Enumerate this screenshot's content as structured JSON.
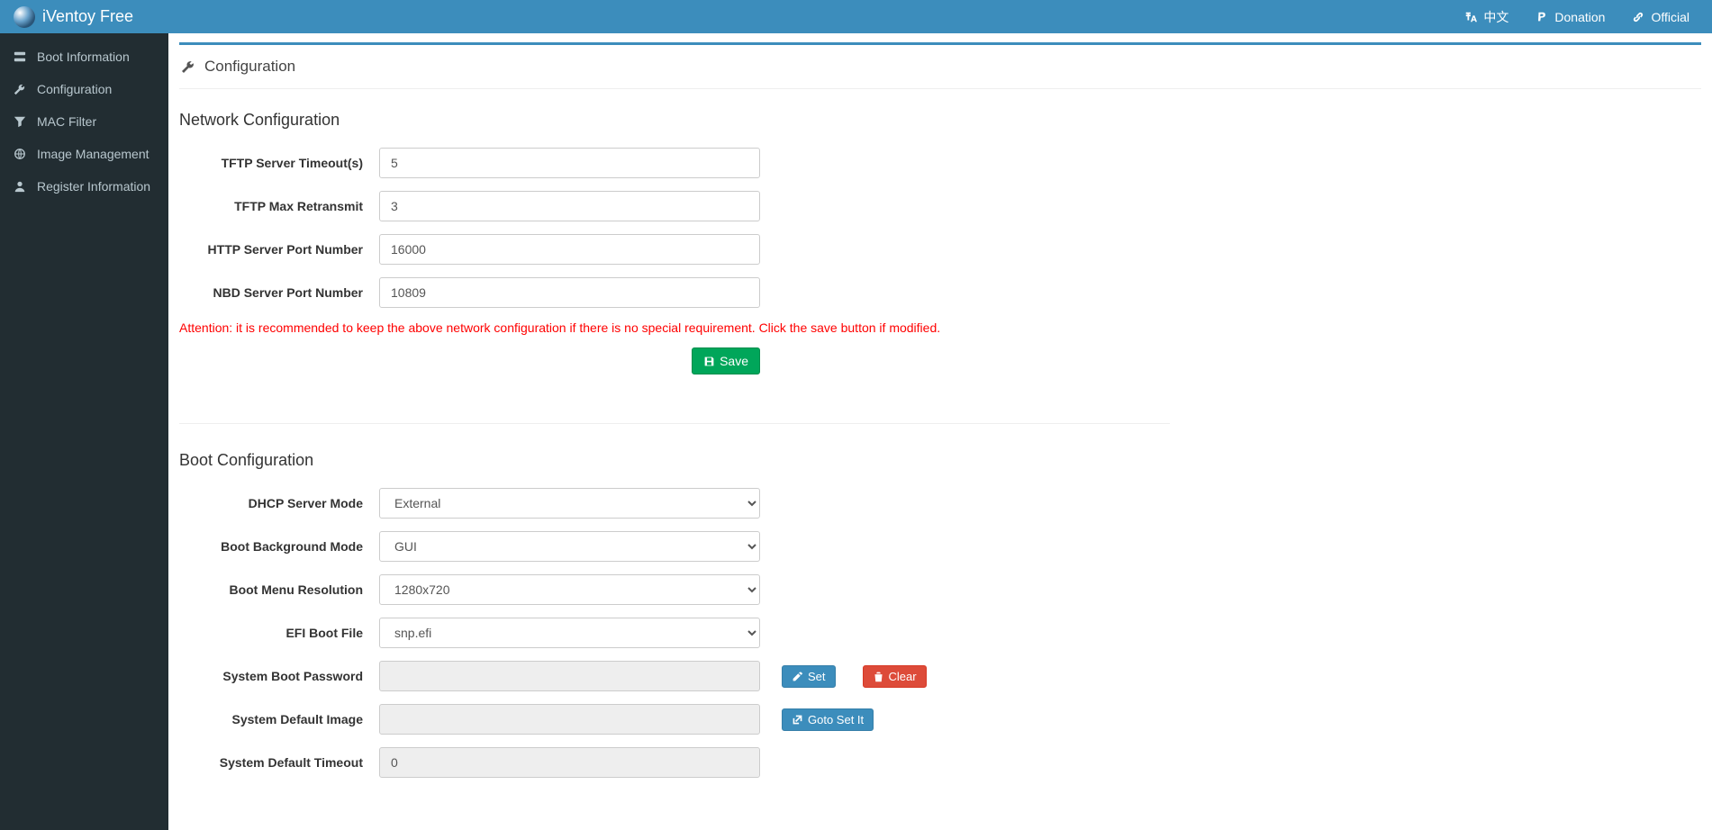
{
  "brand": {
    "title": "iVentoy Free"
  },
  "topnav": {
    "lang": "中文",
    "donation": "Donation",
    "official": "Official"
  },
  "sidebar": {
    "items": [
      {
        "label": "Boot Information"
      },
      {
        "label": "Configuration"
      },
      {
        "label": "MAC Filter"
      },
      {
        "label": "Image Management"
      },
      {
        "label": "Register Information"
      }
    ]
  },
  "page": {
    "title": "Configuration"
  },
  "network": {
    "heading": "Network Configuration",
    "labels": {
      "tftp_timeout": "TFTP Server Timeout(s)",
      "tftp_retransmit": "TFTP Max Retransmit",
      "http_port": "HTTP Server Port Number",
      "nbd_port": "NBD Server Port Number"
    },
    "values": {
      "tftp_timeout": "5",
      "tftp_retransmit": "3",
      "http_port": "16000",
      "nbd_port": "10809"
    },
    "attention": "Attention: it is recommended to keep the above network configuration if there is no special requirement. Click the save button if modified.",
    "save_label": "Save"
  },
  "boot": {
    "heading": "Boot Configuration",
    "labels": {
      "dhcp_mode": "DHCP Server Mode",
      "bg_mode": "Boot Background Mode",
      "resolution": "Boot Menu Resolution",
      "efi_file": "EFI Boot File",
      "password": "System Boot Password",
      "default_image": "System Default Image",
      "default_timeout": "System Default Timeout"
    },
    "values": {
      "dhcp_mode": "External",
      "bg_mode": "GUI",
      "resolution": "1280x720",
      "efi_file": "snp.efi",
      "password": "",
      "default_image": "",
      "default_timeout": "0"
    },
    "buttons": {
      "set": "Set",
      "clear": "Clear",
      "goto": "Goto Set It"
    }
  }
}
